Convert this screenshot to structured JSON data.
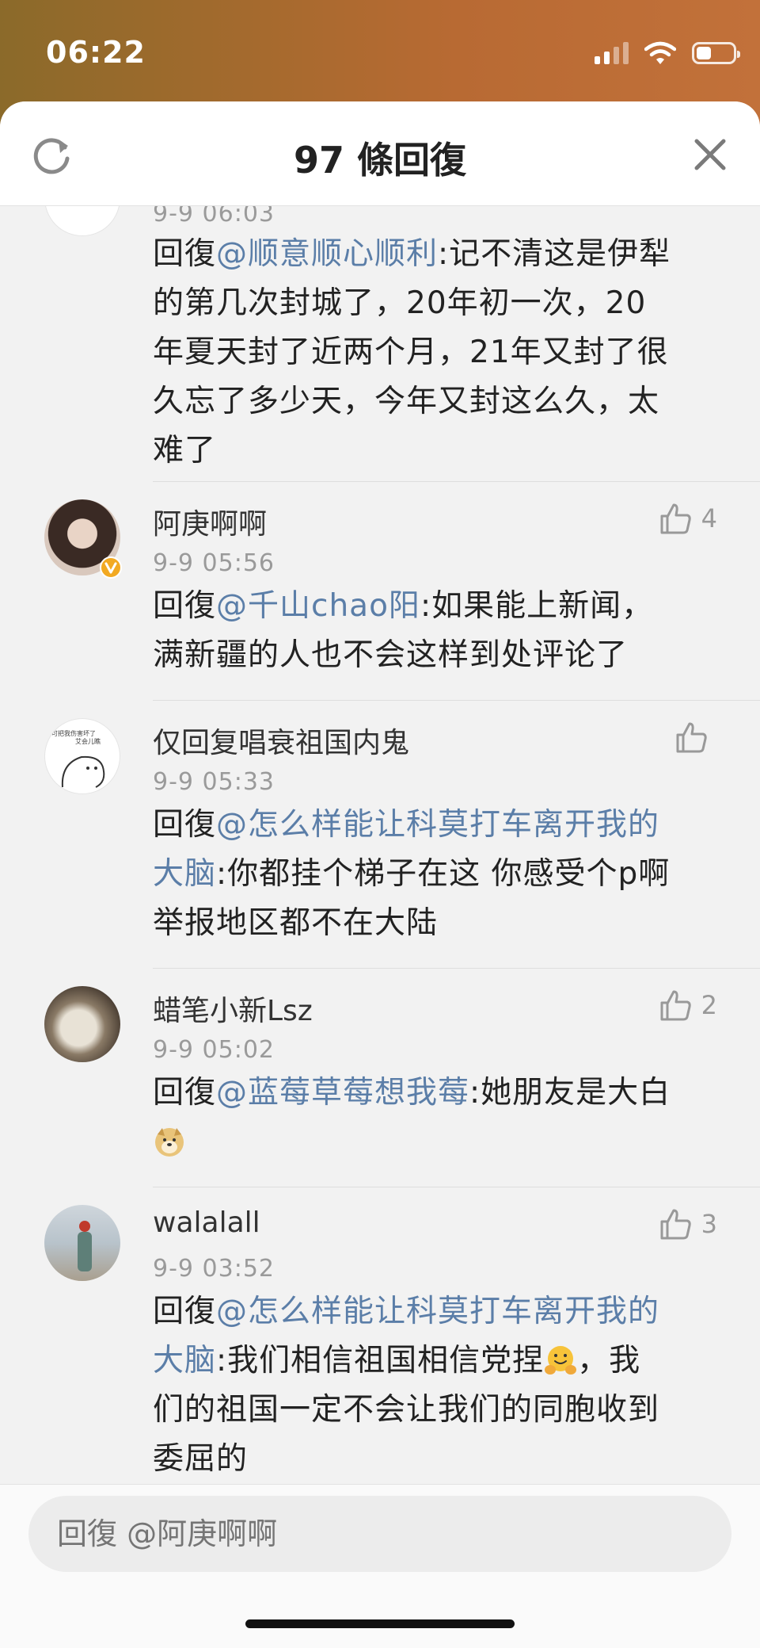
{
  "status": {
    "time": "06:22"
  },
  "header": {
    "title": "97 條回復"
  },
  "comments": [
    {
      "time": "9-9 06:03",
      "reply_prefix": "回復",
      "mention": "@顺意顺心顺利",
      "lines": [
        "的第几次封城了，20年初一次，20",
        "年夏天封了近两个月，21年又封了很",
        "久忘了多少天，今年又封这么久，太",
        "难了"
      ],
      "first_line_rest": ":记不清这是伊犁"
    },
    {
      "name": "阿庚啊啊",
      "time": "9-9 05:56",
      "likes": "4",
      "reply_prefix": "回復",
      "mention": "@千山chao阳",
      "first_line_rest": ":如果能上新闻，",
      "lines": [
        "满新疆的人也不会这样到处评论了"
      ]
    },
    {
      "name": "仅回复唱衰祖国内鬼",
      "time": "9-9 05:33",
      "likes": "",
      "avatar_text_1": "可把我伤害坏了",
      "avatar_text_2": "艾会儿瞧",
      "reply_prefix": "回復",
      "mention_line1": "@怎么样能让科莫打车离开我的",
      "mention_line2": "大脑",
      "second_line_rest": ":你都挂个梯子在这 你感受个p啊",
      "lines": [
        "举报地区都不在大陆"
      ]
    },
    {
      "name": "蜡笔小新Lsz",
      "time": "9-9 05:02",
      "likes": "2",
      "reply_prefix": "回復",
      "mention": "@蓝莓草莓想我莓",
      "first_line_rest": ":她朋友是大白"
    },
    {
      "name": "walalall",
      "time": "9-9 03:52",
      "likes": "3",
      "reply_prefix": "回復",
      "mention_line1": "@怎么样能让科莫打车离开我的",
      "mention_line2": "大脑",
      "second_line_rest": ":我们相信祖国相信党捏",
      "second_line_tail": "，我",
      "lines": [
        "们的祖国一定不会让我们的同胞收到",
        "委屈的"
      ]
    }
  ],
  "reply_bar": {
    "placeholder": "回復 @阿庚啊啊"
  },
  "colors": {
    "mention": "#5b7ea8",
    "sheet_bg": "#f2f2f2",
    "header_bg": "#ffffff"
  }
}
